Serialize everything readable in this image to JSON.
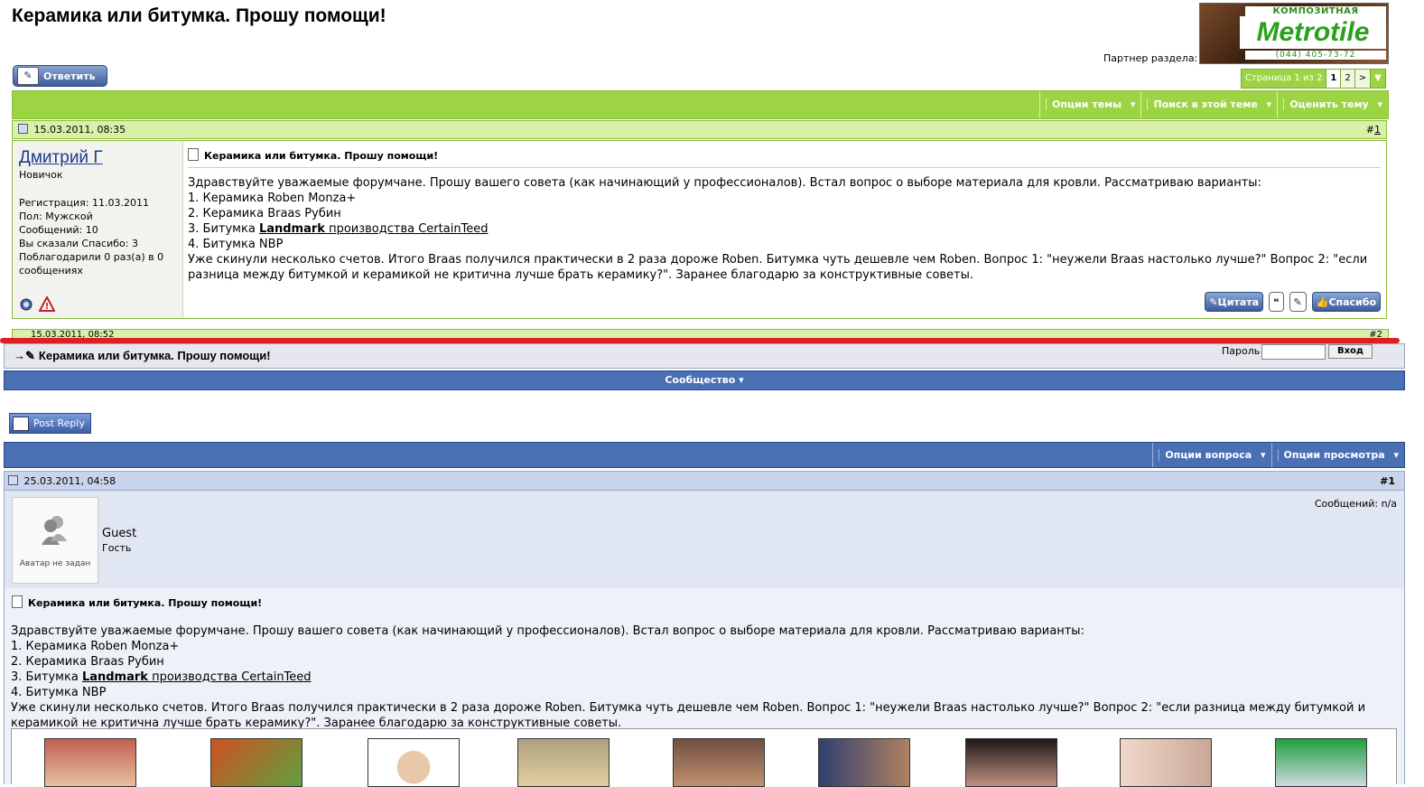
{
  "top": {
    "title": "Керамика или битумка. Прошу помощи!",
    "partner_label": "Партнер раздела:",
    "logo": {
      "tagline": "КОМПОЗИТНАЯ ЧЕРЕПИЦА",
      "brand": "Metrotile",
      "phone": "(044) 405-73-72"
    },
    "reply_button": "Ответить",
    "pager": {
      "info": "Страница 1 из 2",
      "pages": [
        "1",
        "2",
        ">"
      ],
      "current": "1"
    },
    "bar_menus": [
      "Опции темы",
      "Поиск в этой теме",
      "Оценить тему"
    ],
    "post": {
      "date": "15.03.2011, 08:35",
      "number_prefix": "#",
      "number": "1",
      "author": "Дмитрий Г",
      "rank": "Новичок",
      "stats": [
        "Регистрация: 11.03.2011",
        "Пол: Мужской",
        "Сообщений: 10",
        "Вы сказали Спасибо: 3",
        "Поблагодарили 0 раз(а) в 0 сообщениях"
      ],
      "buttons": {
        "quote": "Цитата",
        "thanks": "Спасибо"
      }
    },
    "next_post": {
      "date": "15.03.2011, 08:52",
      "number": "#2"
    }
  },
  "message": {
    "title": "Керамика или битумка. Прошу помощи!",
    "intro": "Здравствуйте уважаемые форумчане. Прошу вашего совета (как начинающий у профессионалов). Встал вопрос о выборе материала для кровли. Рассматриваю варианты:",
    "items": [
      "1. Керамика Roben Monza+",
      "2. Керамика Braas Рубин"
    ],
    "item3_prefix": "3. Битумка ",
    "item3_link_bold": "Landmark",
    "item3_link_rest": " производства CertainTeed",
    "item4": "4. Битумка NBP",
    "outro": "Уже скинули несколько счетов. Итого Braas получился практически в 2 раза дороже Roben. Битумка чуть дешевле чем Roben. Вопрос 1: \"неужели Braas настолько лучше?\" Вопрос 2: \"если разница между битумкой и керамикой не критична лучше брать керамику?\". Заранее благодарю за конструктивные советы."
  },
  "bottom": {
    "thread_title": "Керамика или битумка. Прошу помощи!",
    "password_label": "Пароль",
    "login_button": "Вход",
    "community_bar": "Сообщество",
    "post_reply_button": "Post Reply",
    "bar_menus": [
      "Опции вопроса",
      "Опции просмотра"
    ],
    "post": {
      "date": "25.03.2011, 04:58",
      "number": "#1",
      "avatar_caption": "Аватар не задан",
      "author": "Guest",
      "rank": "Гость",
      "messages": "Сообщений: n/a"
    }
  },
  "colors": {
    "green_bar": "#9cd444",
    "blue_bar": "#4a70b4",
    "red_divider": "#e02020"
  }
}
